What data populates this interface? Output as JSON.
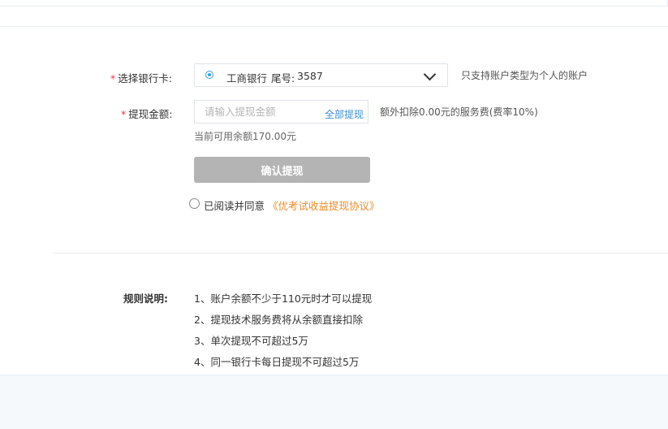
{
  "form": {
    "bank_card": {
      "required_mark": "*",
      "label": "选择银行卡:",
      "bank_name": "工商银行",
      "tail_label": "尾号:",
      "tail_number": "3587",
      "note": "只支持账户类型为个人的账户"
    },
    "amount": {
      "required_mark": "*",
      "label": "提现金额:",
      "placeholder": "请输入提现金额",
      "value": "",
      "all_link": "全部提现",
      "fee_note": "额外扣除0.00元的服务费(费率10%)",
      "available": "当前可用余额170.00元"
    },
    "confirm_label": "确认提现",
    "agreement": {
      "text": "已阅读并同意",
      "link": "《优考试收益提现协议》"
    }
  },
  "rules": {
    "title": "规则说明:",
    "items": [
      "1、账户余额不少于110元时才可以提现",
      "2、提现技术服务费将从余额直接扣除",
      "3、单次提现不可超过5万",
      "4、同一银行卡每日提现不可超过5万"
    ]
  },
  "colors": {
    "required": "#e23b3b",
    "link": "#3c8fd6",
    "agreement_link": "#f08c2b",
    "button_disabled": "#b4b4b4",
    "radio_accent": "#3a9fe0"
  }
}
